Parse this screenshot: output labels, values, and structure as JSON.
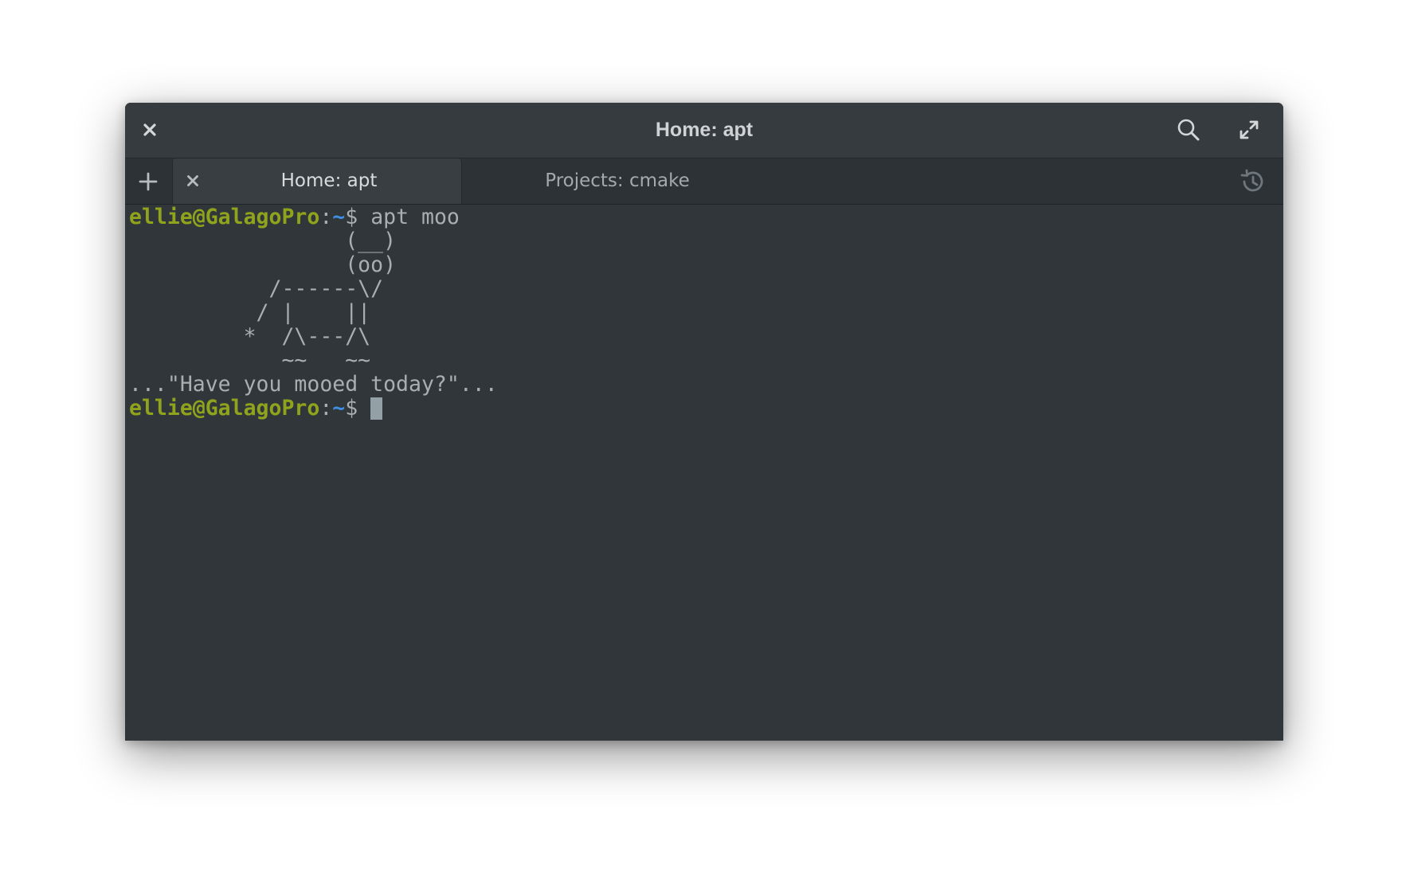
{
  "window": {
    "title": "Home: apt"
  },
  "titlebar": {
    "close_icon": "close-icon",
    "search_icon": "search-icon",
    "fullscreen_icon": "fullscreen-icon"
  },
  "tabs": {
    "new_tab_icon": "plus-icon",
    "history_icon": "history-icon",
    "items": [
      {
        "label": "Home: apt",
        "active": true
      },
      {
        "label": "Projects: cmake",
        "active": false
      }
    ]
  },
  "terminal": {
    "prompt": {
      "user_host": "ellie@GalagoPro",
      "colon": ":",
      "path": "~",
      "symbol": "$ "
    },
    "command": "apt moo",
    "output_lines": [
      "                 (__)",
      "                 (oo)",
      "           /------\\/",
      "          / |    ||",
      "         *  /\\---/\\",
      "            ~~   ~~",
      "...\"Have you mooed today?\"..."
    ],
    "cursor": "block"
  },
  "colors": {
    "window_bg": "#30363a",
    "titlebar_bg": "#353b3f",
    "tabbar_bg": "#2d3236",
    "active_tab_bg": "#383e42",
    "text": "#a9aeb1",
    "prompt_user": "#8fa31c",
    "prompt_path": "#3f8fe0",
    "cursor": "#93a1a6"
  }
}
